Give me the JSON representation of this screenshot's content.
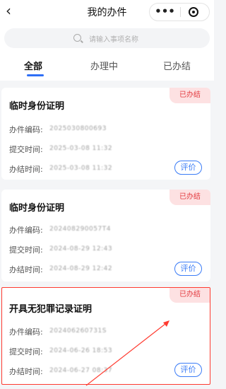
{
  "nav": {
    "title": "我的办件",
    "more": "•••"
  },
  "search": {
    "placeholder": "请输入事项名称"
  },
  "tabs": [
    {
      "label": "全部",
      "active": true
    },
    {
      "label": "办理中",
      "active": false
    },
    {
      "label": "已办结",
      "active": false
    }
  ],
  "field_labels": {
    "code": "办件编码:",
    "submit": "提交时间:",
    "done": "办结时间:"
  },
  "cards": [
    {
      "status": "已办结",
      "title": "临时身份证明",
      "code": "2025030800693",
      "submit_time": "2025-03-08 11:32",
      "done_time": "2025-03-08 11:32",
      "rate_label": "评价"
    },
    {
      "status": "已办结",
      "title": "临时身份证明",
      "code": "202408290057T4",
      "submit_time": "2024-08-29 12:43",
      "done_time": "2024-08-29 12:42",
      "rate_label": "评价"
    },
    {
      "status": "已办结",
      "title": "开具无犯罪记录证明",
      "code": "202406260731S",
      "submit_time": "2024-06-26 18:53",
      "done_time": "2024-06-27 08:37",
      "rate_label": "评价"
    }
  ],
  "colors": {
    "accent": "#2f6ff6",
    "status_red": "#e33b40",
    "annotation": "#ff3b30"
  }
}
